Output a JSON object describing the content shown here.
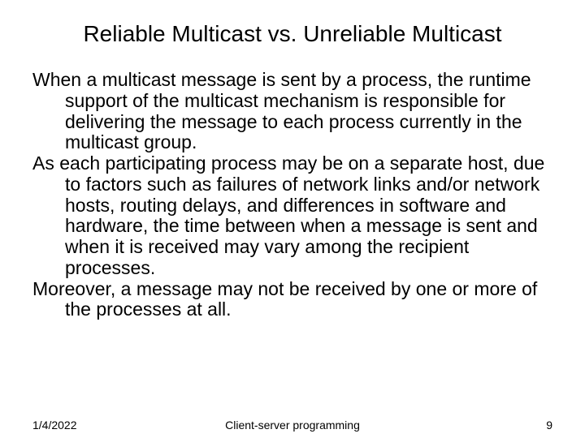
{
  "title": "Reliable Multicast vs. Unreliable Multicast",
  "paragraphs": {
    "p1": "When a multicast message is sent by a process, the runtime support of the multicast mechanism is responsible for delivering the message to each process currently in the multicast group.",
    "p2": "As each participating process may be on a separate host, due to factors such as failures of network links and/or network hosts, routing delays, and differences in software and hardware, the time between when a message is sent and when it is received may vary among the recipient processes.",
    "p3": "Moreover, a message may not be received by one or more of the processes at all."
  },
  "footer": {
    "date": "1/4/2022",
    "center": "Client-server programming",
    "page": "9"
  }
}
